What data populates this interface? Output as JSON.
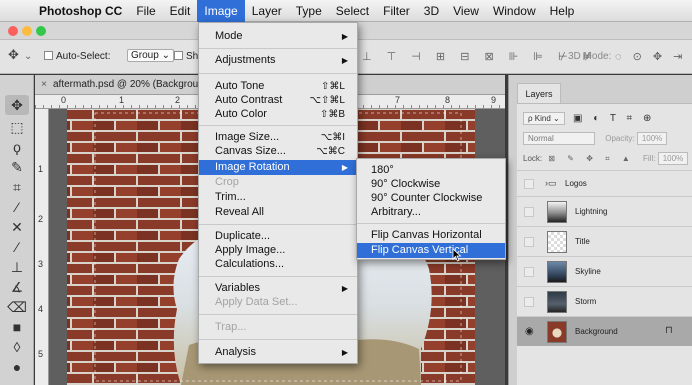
{
  "menubar": {
    "app_name": "Photoshop CC",
    "items": [
      "File",
      "Edit",
      "Image",
      "Layer",
      "Type",
      "Select",
      "Filter",
      "3D",
      "View",
      "Window",
      "Help"
    ],
    "active": "Image"
  },
  "options_bar": {
    "auto_select_label": "Auto-Select:",
    "auto_select_value": "Group",
    "truncated_label": "Sh",
    "mode_label": "3D Mode:"
  },
  "document": {
    "tab_title": "aftermath.psd @ 20% (Backgroun",
    "hruler_numbers": [
      "0",
      "1",
      "2",
      "7",
      "8",
      "9"
    ],
    "vruler_numbers": [
      "1",
      "2",
      "3",
      "4",
      "5"
    ]
  },
  "image_menu": {
    "items": [
      {
        "label": "Mode",
        "submenu": true
      },
      {
        "label": "Adjustments",
        "submenu": true
      },
      {
        "label": "Auto Tone",
        "shortcut": "⇧⌘L"
      },
      {
        "label": "Auto Contrast",
        "shortcut": "⌥⇧⌘L"
      },
      {
        "label": "Auto Color",
        "shortcut": "⇧⌘B"
      },
      {
        "label": "Image Size...",
        "shortcut": "⌥⌘I"
      },
      {
        "label": "Canvas Size...",
        "shortcut": "⌥⌘C"
      },
      {
        "label": "Image Rotation",
        "submenu": true,
        "highlighted": true
      },
      {
        "label": "Crop",
        "disabled": true
      },
      {
        "label": "Trim..."
      },
      {
        "label": "Reveal All"
      },
      {
        "label": "Duplicate..."
      },
      {
        "label": "Apply Image..."
      },
      {
        "label": "Calculations..."
      },
      {
        "label": "Variables",
        "submenu": true
      },
      {
        "label": "Apply Data Set...",
        "disabled": true
      },
      {
        "label": "Trap...",
        "disabled": true
      },
      {
        "label": "Analysis",
        "submenu": true
      }
    ]
  },
  "rotation_submenu": {
    "items": [
      {
        "label": "180°"
      },
      {
        "label": "90° Clockwise"
      },
      {
        "label": "90° Counter Clockwise"
      },
      {
        "label": "Arbitrary..."
      },
      {
        "label": "Flip Canvas Horizontal"
      },
      {
        "label": "Flip Canvas Vertical",
        "highlighted": true
      }
    ]
  },
  "layers_panel": {
    "tab_label": "Layers",
    "filter_label": "ρ Kind",
    "blend_mode": "Normal",
    "opacity_label": "Opacity:",
    "opacity_value": "100%",
    "lock_label": "Lock:",
    "fill_label": "Fill:",
    "fill_value": "100%",
    "layers": [
      {
        "name": "Logos",
        "type": "group"
      },
      {
        "name": "Lightning"
      },
      {
        "name": "Title"
      },
      {
        "name": "Skyline"
      },
      {
        "name": "Storm"
      },
      {
        "name": "Background",
        "selected": true,
        "visible": true,
        "locked": true
      }
    ]
  },
  "colors": {
    "accent": "#2f6fd7",
    "menu_bg": "#e9e9e9",
    "brick": "#8a3a28"
  }
}
